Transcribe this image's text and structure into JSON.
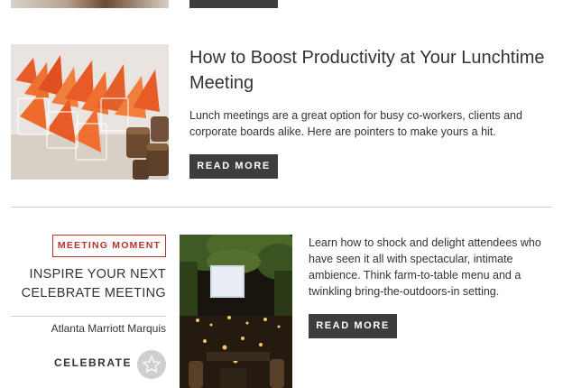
{
  "top_partial": {
    "button_label": ""
  },
  "article": {
    "title": "How to Boost Productivity at Your Lunchtime Meeting",
    "description": "Lunch meetings are a great option for busy co-workers, clients and corporate boards alike. Here are pointers to make yours a hit.",
    "button_label": "READ MORE"
  },
  "meeting_moment": {
    "badge": "MEETING MOMENT",
    "title_line1": "INSPIRE YOUR NEXT",
    "title_line2": "CELEBRATE MEETING",
    "venue": "Atlanta Marriott Marquis",
    "category": "CELEBRATE",
    "category_icon": "star-icon",
    "description": "Learn how to shock and delight attendees who have seen it all with spectacular, intimate ambience. Think farm-to-table menu and a twinkling bring-the-outdoors-in setting.",
    "button_label": "READ MORE"
  },
  "colors": {
    "button_bg": "#3d3d3d",
    "accent_red": "#b8322e",
    "divider": "#cfcfcf"
  }
}
